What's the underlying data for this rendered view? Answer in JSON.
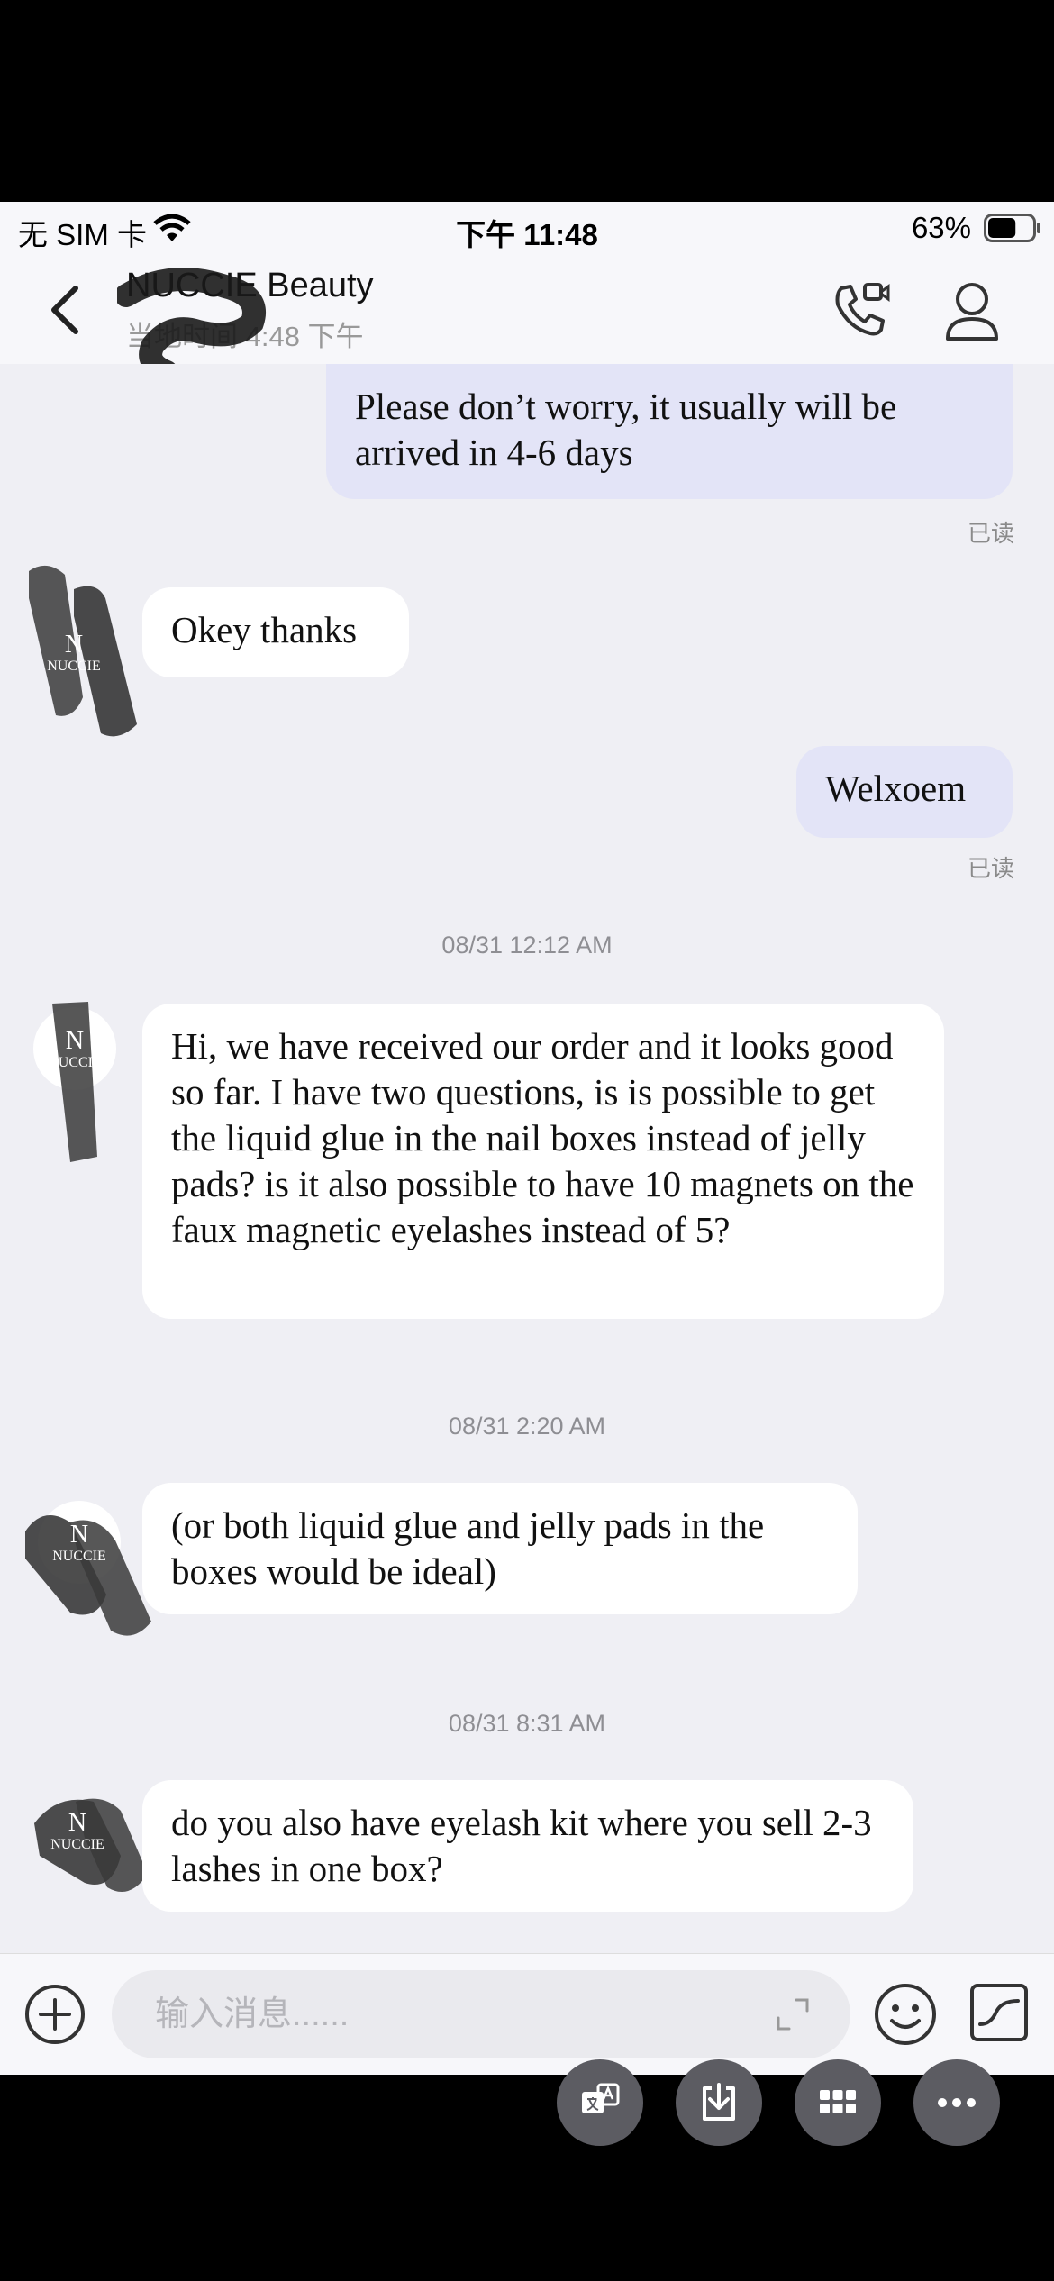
{
  "status_bar": {
    "carrier": "无 SIM 卡",
    "time": "下午 11:48",
    "battery_percent": "63%",
    "battery_level": 0.63
  },
  "header": {
    "contact_name": "NUCCIE Beauty",
    "contact_subtitle": "当地时间 4:48 下午"
  },
  "messages": {
    "m1": {
      "text": "Please don’t worry, it usually will be arrived in 4-6 days",
      "status": "已读"
    },
    "m2": {
      "text": "Okey thanks"
    },
    "m3": {
      "text": "Welxoem",
      "status": "已读"
    },
    "ts1": "08/31 12:12 AM",
    "m4": {
      "text": "Hi, we have received our order and it looks good so far. I have two questions, is is possible to get the liquid glue in the nail boxes instead of jelly pads? is it also possible to have 10 magnets on the faux magnetic eyelashes instead of 5?"
    },
    "ts2": "08/31 2:20 AM",
    "m5": {
      "text": "(or both liquid glue and jelly pads in the boxes would be ideal)"
    },
    "ts3": "08/31 8:31 AM",
    "m6": {
      "text": "do you also have eyelash kit where you sell 2-3 lashes in one box?"
    }
  },
  "input": {
    "placeholder": "输入消息......"
  },
  "avatar": {
    "logo_letter": "N",
    "logo_word": "NUCCIE"
  },
  "floating_buttons": [
    "translate-icon",
    "download-icon",
    "grid-icon",
    "more-icon"
  ],
  "colors": {
    "outgoing_bubble": "#e3e4f7",
    "incoming_bubble": "#ffffff",
    "chat_bg": "#efeff4"
  }
}
